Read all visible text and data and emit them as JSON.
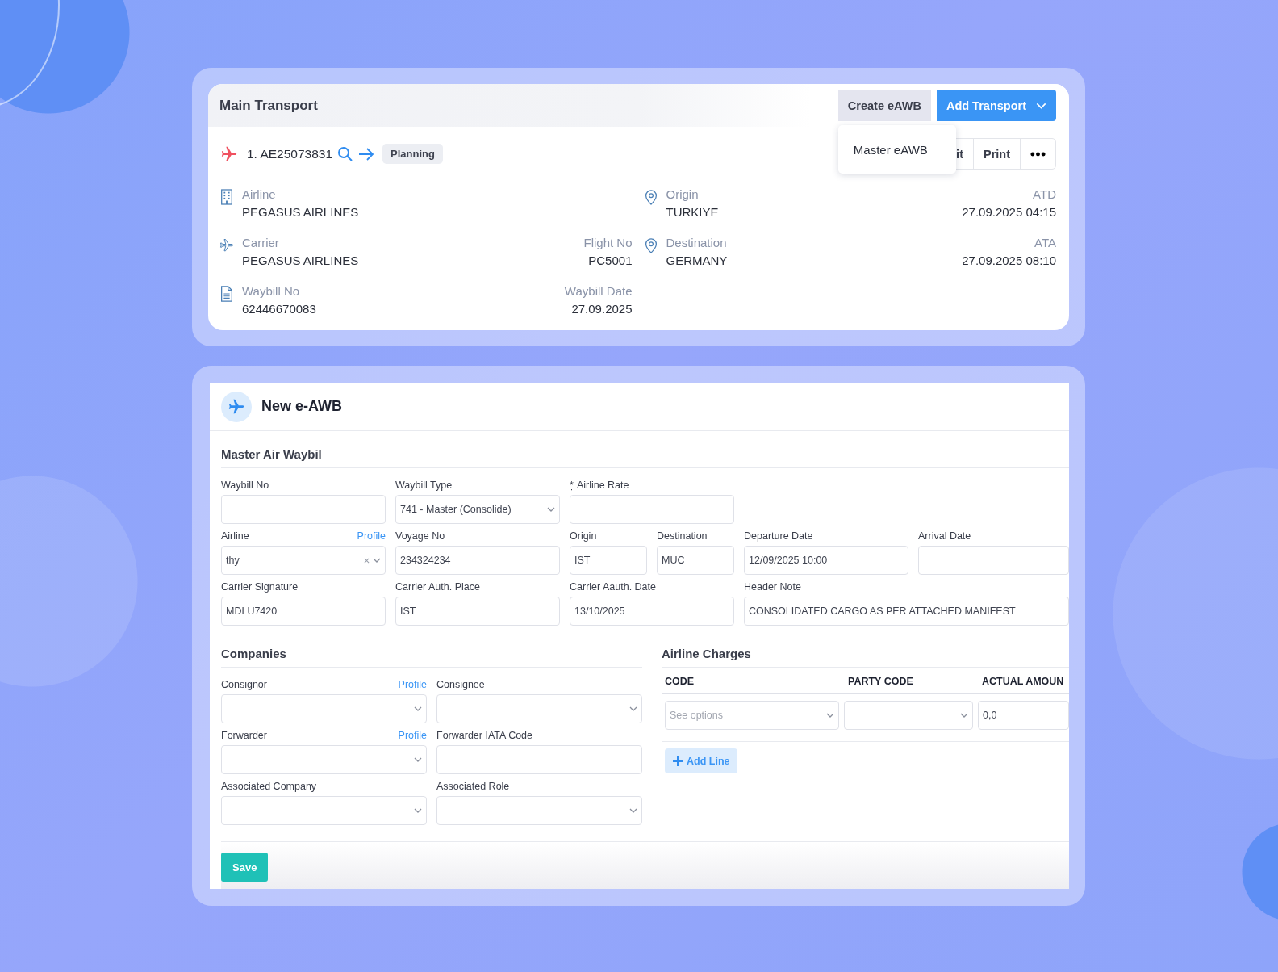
{
  "main_transport": {
    "title": "Main Transport",
    "actions": [
      {
        "label": "Create eAWB",
        "kind": "secondary"
      },
      {
        "label": "Add Transport",
        "kind": "primary"
      }
    ],
    "menu": {
      "items": [
        "Master eAWB"
      ]
    },
    "transport": {
      "label": "1. AE25073831",
      "status": "Planning"
    },
    "toolbar": [
      "it",
      "Print"
    ],
    "details": [
      {
        "kind": "building",
        "label": "Airline",
        "value": "PEGASUS AIRLINES"
      },
      {
        "kind": "pin",
        "label": "Origin",
        "value": "TURKIYE",
        "aside_label": "ATD",
        "aside_value": "27.09.2025 04:15"
      },
      {
        "kind": "plane",
        "label": "Carrier",
        "value": "PEGASUS AIRLINES",
        "aside_label": "Flight No",
        "aside_value": "PC5001"
      },
      {
        "kind": "pin",
        "label": "Destination",
        "value": "GERMANY",
        "aside_label": "ATA",
        "aside_value": "27.09.2025 08:10"
      },
      {
        "kind": "document",
        "label": "Waybill No",
        "value": "62446670083",
        "aside_label": "Waybill Date",
        "aside_value": "27.09.2025"
      }
    ]
  },
  "eawb": {
    "title": "New e-AWB",
    "waybill_section": {
      "title": "Master Air Waybil",
      "rows": [
        [
          {
            "label": "Waybill No",
            "kind": "text"
          },
          {
            "label": "Waybill Type",
            "kind": "select",
            "value": "741 - Master (Consolide)"
          },
          {
            "label": "Airline Rate",
            "marker": "*",
            "kind": "text"
          }
        ],
        [
          {
            "label": "Airline",
            "link": "Profile",
            "kind": "clearable",
            "value": "thy"
          },
          {
            "label": "Voyage No",
            "kind": "text",
            "value": "234324234"
          },
          {
            "kind": "pair",
            "fields": [
              {
                "label": "Origin",
                "value": "IST"
              },
              {
                "label": "Destination",
                "value": "MUC"
              }
            ]
          },
          {
            "label": "Departure Date",
            "kind": "text",
            "value": "12/09/2025 10:00"
          },
          {
            "label": "Arrival Date",
            "kind": "text"
          }
        ],
        [
          {
            "label": "Carrier Signature",
            "kind": "text",
            "value": "MDLU7420"
          },
          {
            "label": "Carrier Auth. Place",
            "kind": "text",
            "value": "IST"
          },
          {
            "label": "Carrier Aauth. Date",
            "kind": "text",
            "value": "13/10/2025"
          },
          {
            "label": "Header Note",
            "kind": "wide",
            "value": "CONSOLIDATED CARGO AS PER ATTACHED MANIFEST"
          }
        ]
      ]
    },
    "companies": {
      "title": "Companies",
      "fields": [
        {
          "label": "Consignor",
          "link": "Profile",
          "kind": "select"
        },
        {
          "label": "Consignee",
          "kind": "select"
        },
        {
          "label": "Forwarder",
          "link": "Profile",
          "kind": "select"
        },
        {
          "label": "Forwarder IATA Code",
          "kind": "text"
        },
        {
          "label": "Associated Company",
          "kind": "select"
        },
        {
          "label": "Associated Role",
          "kind": "select"
        }
      ]
    },
    "charges": {
      "title": "Airline Charges",
      "columns": [
        "CODE",
        "PARTY CODE",
        "ACTUAL AMOUN"
      ],
      "row": [
        {
          "kind": "select",
          "placeholder": "See options"
        },
        {
          "kind": "select"
        },
        {
          "kind": "text",
          "value": "0,0"
        }
      ],
      "add_button": "Add Line"
    },
    "save_button": "Save"
  }
}
